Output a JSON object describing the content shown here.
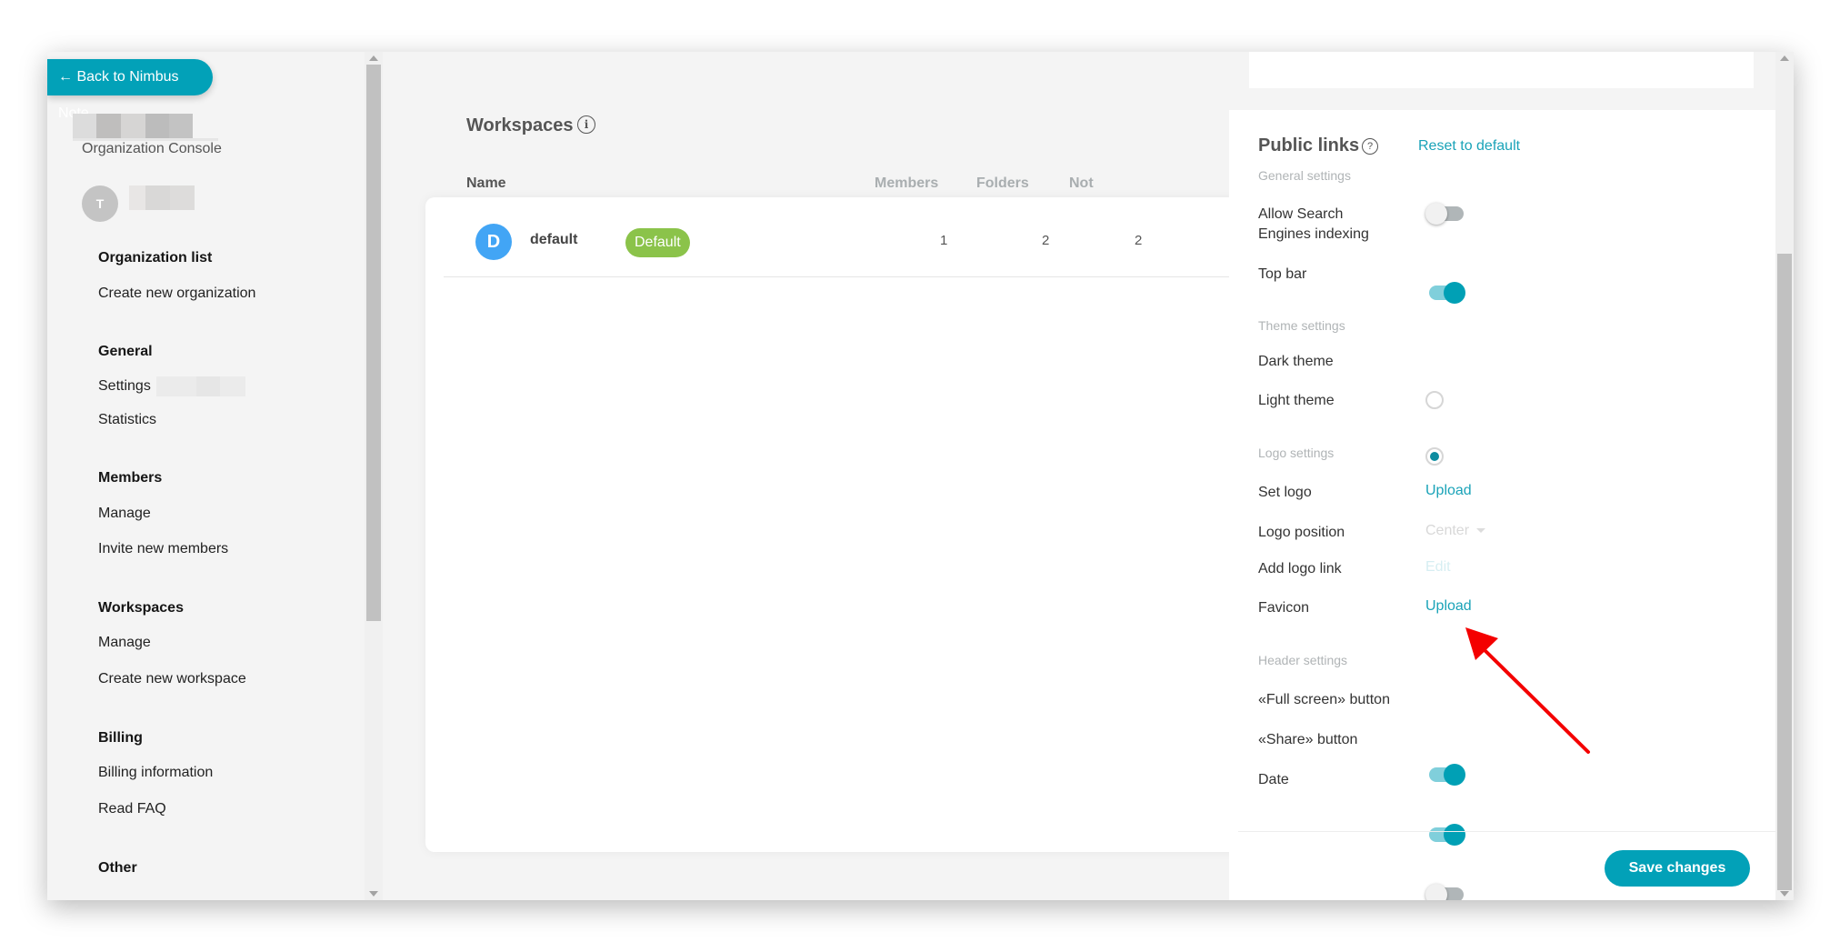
{
  "sidebar": {
    "back_button": "← Back to Nimbus Note",
    "console_label": "Organization Console",
    "user_avatar_letter": "T",
    "sections": [
      {
        "heading": "Organization list",
        "items": [
          "Create new organization"
        ]
      },
      {
        "heading": "General",
        "items": [
          "Settings",
          "Statistics"
        ]
      },
      {
        "heading": "Members",
        "items": [
          "Manage",
          "Invite new members"
        ]
      },
      {
        "heading": "Workspaces",
        "items": [
          "Manage",
          "Create new workspace"
        ]
      },
      {
        "heading": "Billing",
        "items": [
          "Billing information",
          "Read FAQ"
        ]
      },
      {
        "heading": "Other",
        "items": []
      }
    ]
  },
  "main": {
    "title": "Workspaces",
    "info_icon": "i",
    "columns": {
      "name": "Name",
      "members": "Members",
      "folders": "Folders",
      "notes": "Not"
    },
    "rows": [
      {
        "avatar": "D",
        "name": "default",
        "badge": "Default",
        "members": "1",
        "folders": "2",
        "notes": "2"
      }
    ]
  },
  "panel": {
    "title": "Public links",
    "help_icon": "?",
    "reset_link": "Reset to default",
    "general_settings": "General settings",
    "allow_search_line1": "Allow Search",
    "allow_search_line2": "Engines indexing",
    "allow_search_on": false,
    "top_bar": "Top bar",
    "top_bar_on": true,
    "theme_settings": "Theme settings",
    "dark_theme": "Dark theme",
    "light_theme": "Light theme",
    "selected_theme": "light",
    "logo_settings": "Logo settings",
    "set_logo": "Set logo",
    "set_logo_action": "Upload",
    "logo_position": "Logo position",
    "logo_position_value": "Center",
    "add_logo_link": "Add logo link",
    "add_logo_link_action": "Edit",
    "favicon": "Favicon",
    "favicon_action": "Upload",
    "header_settings": "Header settings",
    "full_screen": "«Full screen» button",
    "full_screen_on": true,
    "share": "«Share» button",
    "share_on": true,
    "date": "Date",
    "date_on": false,
    "save_button": "Save changes"
  },
  "colors": {
    "accent": "#02a1b8",
    "badge": "#8bc34a",
    "ws_avatar": "#42a5f5",
    "annotation_arrow": "#f40000"
  }
}
